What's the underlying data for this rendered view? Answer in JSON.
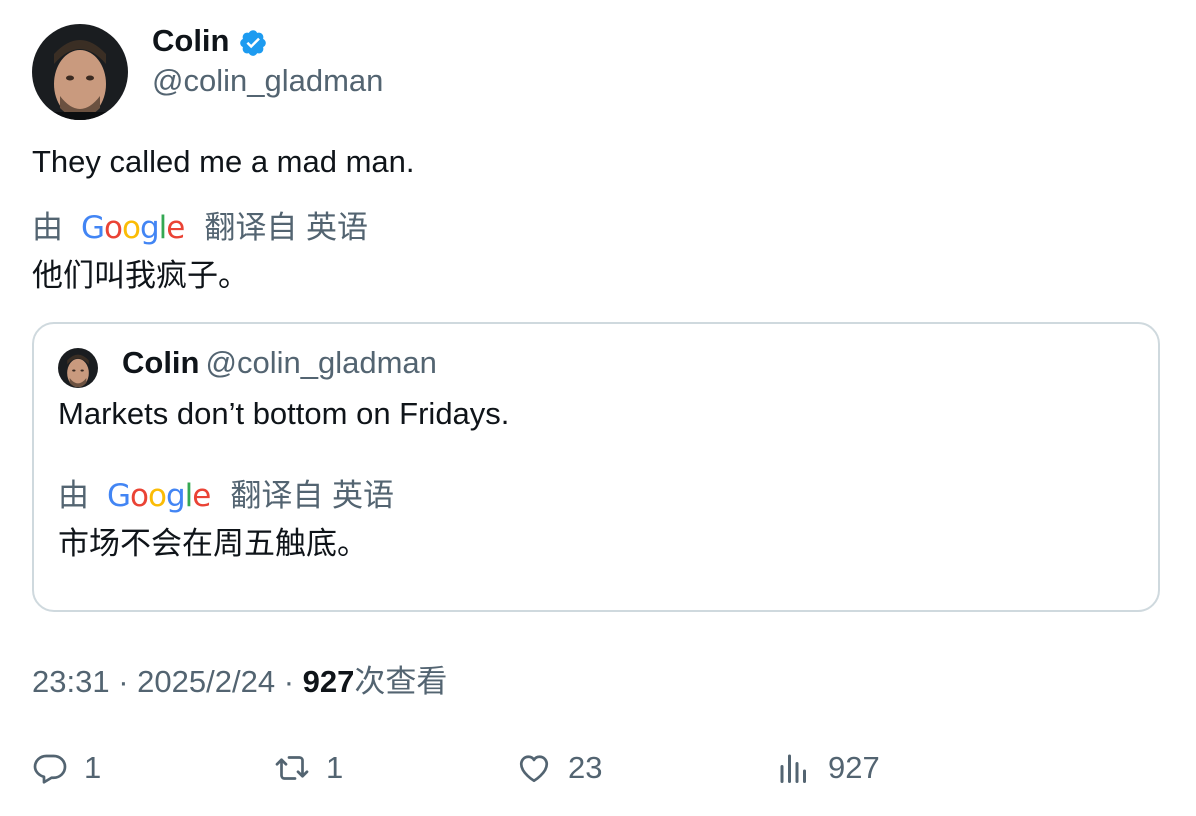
{
  "author": {
    "name": "Colin",
    "handle": "@colin_gladman"
  },
  "tweet": {
    "text": "They called me a mad man.",
    "translation": {
      "by_label": "由",
      "logo": "Google",
      "from_label": "翻译自 英语",
      "text": "他们叫我疯子。"
    }
  },
  "quote": {
    "name": "Colin",
    "handle": "@colin_gladman",
    "text": "Markets don’t bottom on Fridays.",
    "translation": {
      "by_label": "由",
      "logo": "Google",
      "from_label": "翻译自 英语",
      "text": "市场不会在周五触底。"
    }
  },
  "meta": {
    "time": "23:31",
    "date": "2025/2/24",
    "sep": "·",
    "views_count": "927",
    "views_label": "次查看"
  },
  "actions": {
    "replies": "1",
    "retweets": "1",
    "likes": "23",
    "views": "927"
  },
  "colors": {
    "verified": "#1d9bf0",
    "muted_text": "#536471",
    "border": "#cfd9de",
    "google_blue": "#4285F4",
    "google_red": "#EA4335",
    "google_yellow": "#FBBC05",
    "google_green": "#34A853"
  },
  "icons": [
    "verified-badge-icon",
    "reply-icon",
    "retweet-icon",
    "like-icon",
    "views-icon"
  ]
}
